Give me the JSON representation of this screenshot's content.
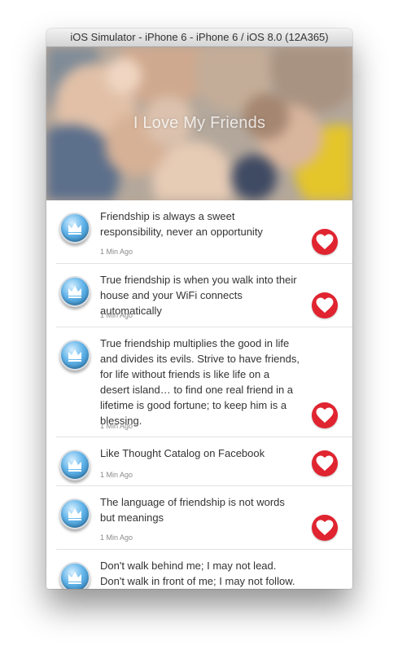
{
  "window": {
    "title": "iOS Simulator - iPhone 6 - iPhone 6 / iOS 8.0 (12A365)"
  },
  "header": {
    "title": "I Love My Friends"
  },
  "quotes": [
    {
      "text": "Friendship is always a sweet responsibility, never an opportunity",
      "time": "1 Min Ago"
    },
    {
      "text": "True friendship is when you walk into their house and your WiFi connects automatically",
      "time": "1 Min Ago"
    },
    {
      "text": "True friendship multiplies the good in life and divides its evils. Strive to have friends, for life without friends is like life on a desert island… to find one real friend in a lifetime is good fortune; to keep him is a blessing.",
      "time": "1 Min Ago"
    },
    {
      "text": "Like Thought Catalog on Facebook",
      "time": "1 Min Ago"
    },
    {
      "text": "The language of friendship is not words but meanings",
      "time": "1 Min Ago"
    },
    {
      "text": "Don't walk behind me; I may not lead. Don't walk in front of me; I may not follow. Just walk beside",
      "time": ""
    }
  ],
  "icons": {
    "avatar": "crown-icon",
    "like": "heart-icon"
  },
  "colors": {
    "like_red": "#e02430",
    "avatar_blue": "#3d8fd0"
  }
}
